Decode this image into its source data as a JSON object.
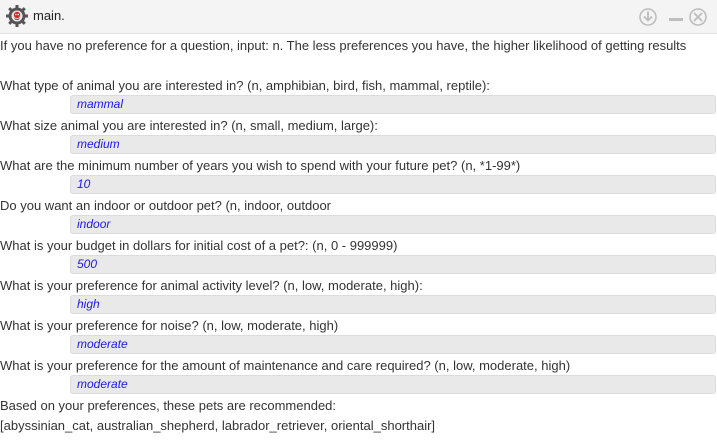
{
  "window": {
    "title": "main.",
    "icon": "gear-icon",
    "controls": [
      "download-icon",
      "minimize-icon",
      "close-icon"
    ]
  },
  "intro": "If you have no preference for a question, input: n. The less preferences you have, the higher likelihood of getting results",
  "questions": [
    {
      "prompt": "What type of animal you are interested in? (n, amphibian, bird, fish, mammal, reptile):",
      "answer": "mammal"
    },
    {
      "prompt": "What size animal you are interested in? (n, small, medium, large):",
      "answer": "medium"
    },
    {
      "prompt": "What are the minimum number of years you wish to spend with your future pet? (n, *1-99*)",
      "answer": "10"
    },
    {
      "prompt": "Do you want an indoor or outdoor pet? (n, indoor, outdoor",
      "answer": "indoor"
    },
    {
      "prompt": "What is your budget in dollars for initial cost of a pet?: (n, 0 - 999999)",
      "answer": "500"
    },
    {
      "prompt": "What is your preference for animal activity level? (n, low, moderate, high):",
      "answer": "high"
    },
    {
      "prompt": "What is your preference for noise? (n, low, moderate, high)",
      "answer": "moderate"
    },
    {
      "prompt": "What is your preference for the amount of maintenance and care required? (n, low, moderate, high)",
      "answer": "moderate"
    }
  ],
  "result_heading": "Based on your preferences, these pets are recommended:",
  "result_list": "[abyssinian_cat, australian_shepherd, labrador_retriever, oriental_shorthair]"
}
